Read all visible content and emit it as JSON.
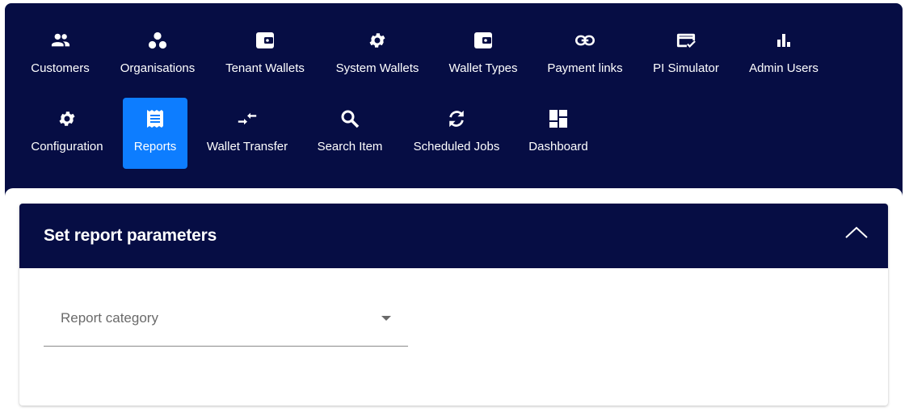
{
  "nav": {
    "row1": [
      {
        "label": "Customers",
        "icon": "people-icon"
      },
      {
        "label": "Organisations",
        "icon": "organisations-icon"
      },
      {
        "label": "Tenant Wallets",
        "icon": "wallet-icon"
      },
      {
        "label": "System Wallets",
        "icon": "gear-icon"
      },
      {
        "label": "Wallet Types",
        "icon": "wallet-icon"
      },
      {
        "label": "Payment links",
        "icon": "link-icon"
      },
      {
        "label": "PI Simulator",
        "icon": "card-check-icon"
      },
      {
        "label": "Admin Users",
        "icon": "bar-chart-icon"
      }
    ],
    "row2": [
      {
        "label": "Configuration",
        "icon": "gear-icon"
      },
      {
        "label": "Reports",
        "icon": "receipt-icon",
        "active": true
      },
      {
        "label": "Wallet Transfer",
        "icon": "transfer-icon"
      },
      {
        "label": "Search Item",
        "icon": "search-icon"
      },
      {
        "label": "Scheduled Jobs",
        "icon": "sync-icon"
      },
      {
        "label": "Dashboard",
        "icon": "dashboard-icon"
      }
    ]
  },
  "panel": {
    "title": "Set report parameters",
    "collapse_icon": "chevron-up-icon",
    "report_category": {
      "label": "Report category",
      "icon": "dropdown-arrow-icon"
    }
  },
  "colors": {
    "navy": "#060d44",
    "accent": "#0d7dff"
  }
}
